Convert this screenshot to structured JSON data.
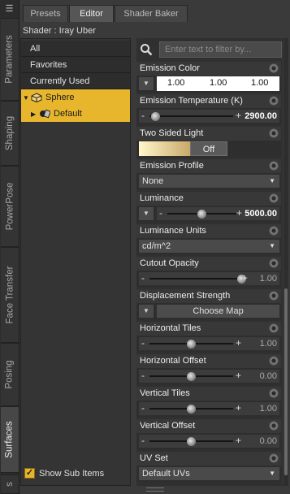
{
  "vertical_tabs": [
    {
      "label": "Parameters",
      "active": false
    },
    {
      "label": "Shaping",
      "active": false
    },
    {
      "label": "PowerPose",
      "active": false
    },
    {
      "label": "Face Transfer",
      "active": false
    },
    {
      "label": "Posing",
      "active": false
    },
    {
      "label": "Surfaces",
      "active": true
    },
    {
      "label": "s",
      "active": false
    }
  ],
  "top_tabs": [
    {
      "label": "Presets",
      "active": false
    },
    {
      "label": "Editor",
      "active": true
    },
    {
      "label": "Shader Baker",
      "active": false
    }
  ],
  "shader_label": "Shader : Iray Uber",
  "list": {
    "items": [
      "All",
      "Favorites",
      "Currently Used"
    ],
    "tree": [
      {
        "label": "Sphere",
        "icon": "cube-icon"
      },
      {
        "label": "Default",
        "icon": "material-icon"
      }
    ],
    "show_sub_items": {
      "label": "Show Sub Items",
      "checked": true
    }
  },
  "search": {
    "placeholder": "Enter text to filter by..."
  },
  "properties": [
    {
      "title": "Emission Color",
      "type": "color",
      "values": [
        "1.00",
        "1.00",
        "1.00"
      ]
    },
    {
      "title": "Emission Temperature (K)",
      "type": "slider",
      "value": "2900.00",
      "fraction": 0.07
    },
    {
      "title": "Two Sided Light",
      "type": "toggle",
      "value": "Off"
    },
    {
      "title": "Emission Profile",
      "type": "dropdown",
      "value": "None"
    },
    {
      "title": "Luminance",
      "type": "slider",
      "value": "5000.00",
      "fraction": 0.5
    },
    {
      "title": "Luminance Units",
      "type": "dropdown",
      "value": "cd/m^2"
    },
    {
      "title": "Cutout Opacity",
      "type": "slider",
      "value": "1.00",
      "fraction": 1.0
    },
    {
      "title": "Displacement Strength",
      "type": "button",
      "value": "Choose Map"
    },
    {
      "title": "Horizontal Tiles",
      "type": "slider",
      "value": "1.00",
      "fraction": 0.5
    },
    {
      "title": "Horizontal Offset",
      "type": "slider",
      "value": "0.00",
      "fraction": 0.5
    },
    {
      "title": "Vertical Tiles",
      "type": "slider",
      "value": "1.00",
      "fraction": 0.5
    },
    {
      "title": "Vertical Offset",
      "type": "slider",
      "value": "0.00",
      "fraction": 0.5
    },
    {
      "title": "UV Set",
      "type": "dropdown",
      "value": "Default UVs"
    }
  ],
  "colors": {
    "selection": "#e8b62d",
    "panel": "#303030",
    "background": "#3a3a3a"
  }
}
